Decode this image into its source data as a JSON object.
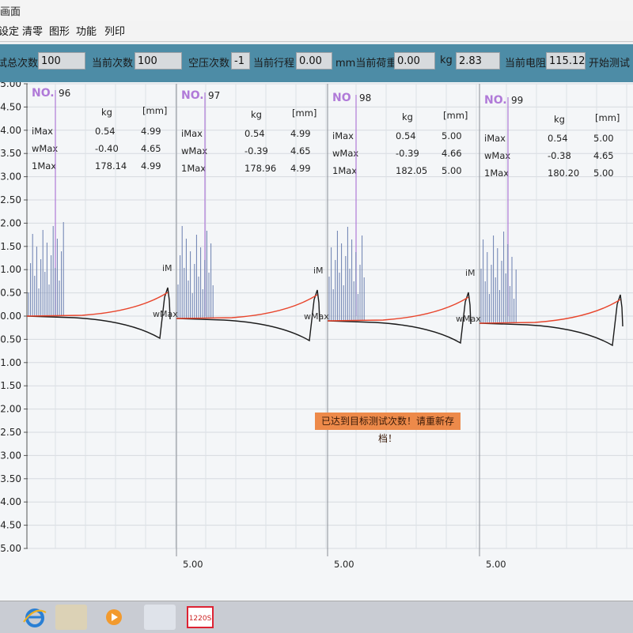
{
  "window": {
    "title": "画面"
  },
  "menu": {
    "items": [
      "设定",
      "清零",
      "图形",
      "功能",
      "列印"
    ]
  },
  "params": {
    "fields": [
      {
        "label": "试总次数",
        "value": "100"
      },
      {
        "label": "当前次数",
        "value": "100"
      },
      {
        "label": "空压次数",
        "value": "-1"
      },
      {
        "label": "当前行程",
        "value": "0.00"
      },
      {
        "label": "mm当前荷重",
        "value": "0.00"
      },
      {
        "label": "kg",
        "value": "2.83"
      },
      {
        "label": "当前电阻",
        "value": "115.12"
      },
      {
        "label": "开始测试",
        "value": ""
      }
    ]
  },
  "chart": {
    "y_ticks": [
      "5.00",
      "4.50",
      "4.00",
      "3.50",
      "3.00",
      "2.50",
      "2.00",
      "1.50",
      "1.00",
      "0.50",
      "0.00",
      "-0.50",
      "-1.00",
      "-1.50",
      "-2.00",
      "-2.50",
      "-3.00",
      "-3.50",
      "-4.00",
      "-4.50",
      "-5.00"
    ],
    "panels": [
      {
        "no_label": "NO.",
        "no_value": "96",
        "col_kg": "kg",
        "col_mm": "[mm]",
        "rows": [
          {
            "name": "iMax",
            "kg": "0.54",
            "mm": "4.99"
          },
          {
            "name": "wMax",
            "kg": "-0.40",
            "mm": "4.65"
          },
          {
            "name": "1Max",
            "kg": "178.14",
            "mm": "4.99"
          }
        ],
        "bottom_label": "",
        "marker_i": "",
        "marker_w": ""
      },
      {
        "no_label": "NO.",
        "no_value": "97",
        "col_kg": "kg",
        "col_mm": "[mm]",
        "rows": [
          {
            "name": "iMax",
            "kg": "0.54",
            "mm": "4.99"
          },
          {
            "name": "wMax",
            "kg": "-0.39",
            "mm": "4.65"
          },
          {
            "name": "1Max",
            "kg": "178.96",
            "mm": "4.99"
          }
        ],
        "bottom_label": "5.00",
        "marker_i": "iM",
        "marker_w": "wMax"
      },
      {
        "no_label": "NO",
        "no_value": "98",
        "col_kg": "kg",
        "col_mm": "[mm]",
        "rows": [
          {
            "name": "iMax",
            "kg": "0.54",
            "mm": "5.00"
          },
          {
            "name": "wMax",
            "kg": "-0.39",
            "mm": "4.66"
          },
          {
            "name": "1Max",
            "kg": "182.05",
            "mm": "5.00"
          }
        ],
        "bottom_label": "5.00",
        "marker_i": "iM",
        "marker_w": "wMax"
      },
      {
        "no_label": "NO.",
        "no_value": "99",
        "col_kg": "kg",
        "col_mm": "[mm]",
        "rows": [
          {
            "name": "iMax",
            "kg": "0.54",
            "mm": "5.00"
          },
          {
            "name": "wMax",
            "kg": "-0.38",
            "mm": "4.65"
          },
          {
            "name": "1Max",
            "kg": "180.20",
            "mm": "5.00"
          }
        ],
        "bottom_label": "5.00",
        "marker_i": "iM",
        "marker_w": "wMax"
      }
    ]
  },
  "status_message": "已达到目标测试次数！请重新存档！",
  "taskbar": {
    "badge_text": "1220S"
  },
  "colors": {
    "param_bar": "#4d8ca6",
    "force_curve": "#e8452c",
    "resist_curve": "#6a7fb0",
    "no_label": "#b07ad8",
    "status_bg": "#ed8a4a"
  }
}
